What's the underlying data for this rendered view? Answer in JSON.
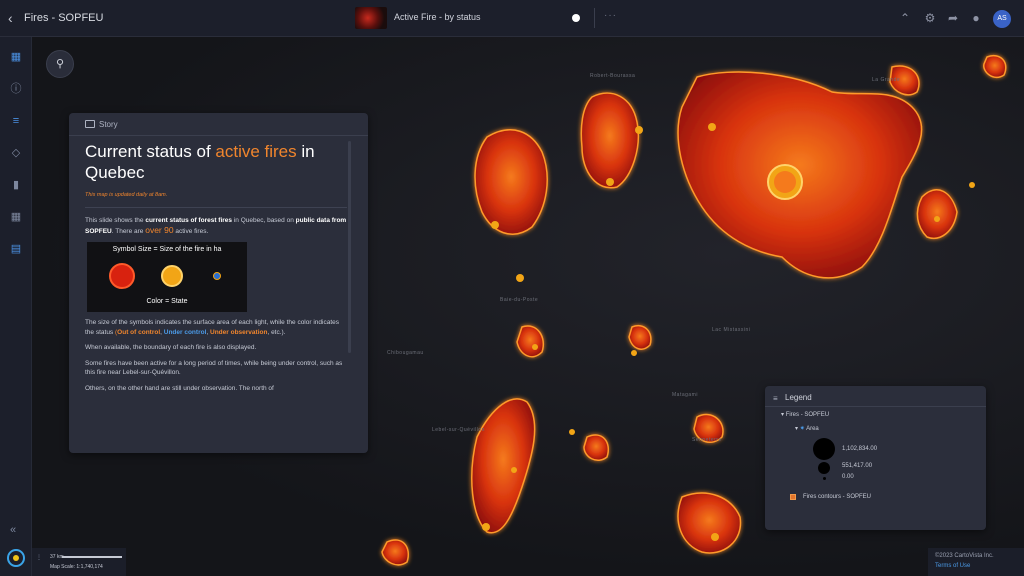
{
  "topbar": {
    "back_icon": "chevron-left-icon",
    "app_title": "Fires - SOPFEU",
    "slide_title": "Active Fire - by status",
    "more": "···",
    "avatar_initials": "AS",
    "icons": [
      "chevrons-up-icon",
      "gear-icon",
      "share-icon",
      "user-avatar"
    ]
  },
  "sidebar": {
    "icons": [
      "map-icon",
      "info-icon",
      "list-icon",
      "layers-icon",
      "chart-icon",
      "table-icon",
      "book-icon"
    ],
    "collapse": "«"
  },
  "map": {
    "place_labels": [
      "Robert-Bourassa",
      "La Grande",
      "Baie-du-Poste",
      "Lac Mistassini",
      "Chibougamau",
      "Lebel-sur-Quévillon",
      "Matagami",
      "Senneterre"
    ],
    "fire_colors": {
      "outer": "#ff7b1a",
      "inner": "#d1220f",
      "symbol": "#f2a516"
    }
  },
  "story": {
    "header": "Story",
    "title_part1": "Current status of ",
    "title_accent": "active fires",
    "title_part2": " in Quebec",
    "note": "This map is updated daily at 8am.",
    "p1_a": "This slide shows the ",
    "p1_b": "current status of forest fires",
    "p1_c": " in Quebec, based on ",
    "p1_d": "public data from SOPFEU",
    "p1_e": ". There are ",
    "p1_f": "over 90",
    "p1_g": " active fires.",
    "symbols_top": "Symbol Size = Size of the fire in ha",
    "symbols_bottom": "Color = State",
    "p2_a": "The size of the symbols indicates the surface area of each light, while the color indicates the status ",
    "p2_open": "(",
    "p2_out": "Out of control",
    "p2_comma1": ", ",
    "p2_under": "Under control",
    "p2_comma2": ", ",
    "p2_obs": "Under observation",
    "p2_end": ", etc.).",
    "p3": "When available, the boundary of each fire is also displayed.",
    "p4": "Some fires have been active for a long period of times, while being under control, such as this fire near Lebel-sur-Quévillon.",
    "p5": "Others, on the other hand are still under observation. The north of"
  },
  "legend": {
    "title": "Legend",
    "layer": "Fires - SOPFEU",
    "sublayer": "Area",
    "values": [
      "1,102,834.00",
      "551,417.00",
      "0.00"
    ],
    "contours": "Fires contours - SOPFEU"
  },
  "scale": {
    "distance": "37 km",
    "ratio": "Map Scale: 1:1,740,174"
  },
  "footer": {
    "copyright": "©2023 CartoVista Inc.",
    "terms": "Terms of Use"
  }
}
